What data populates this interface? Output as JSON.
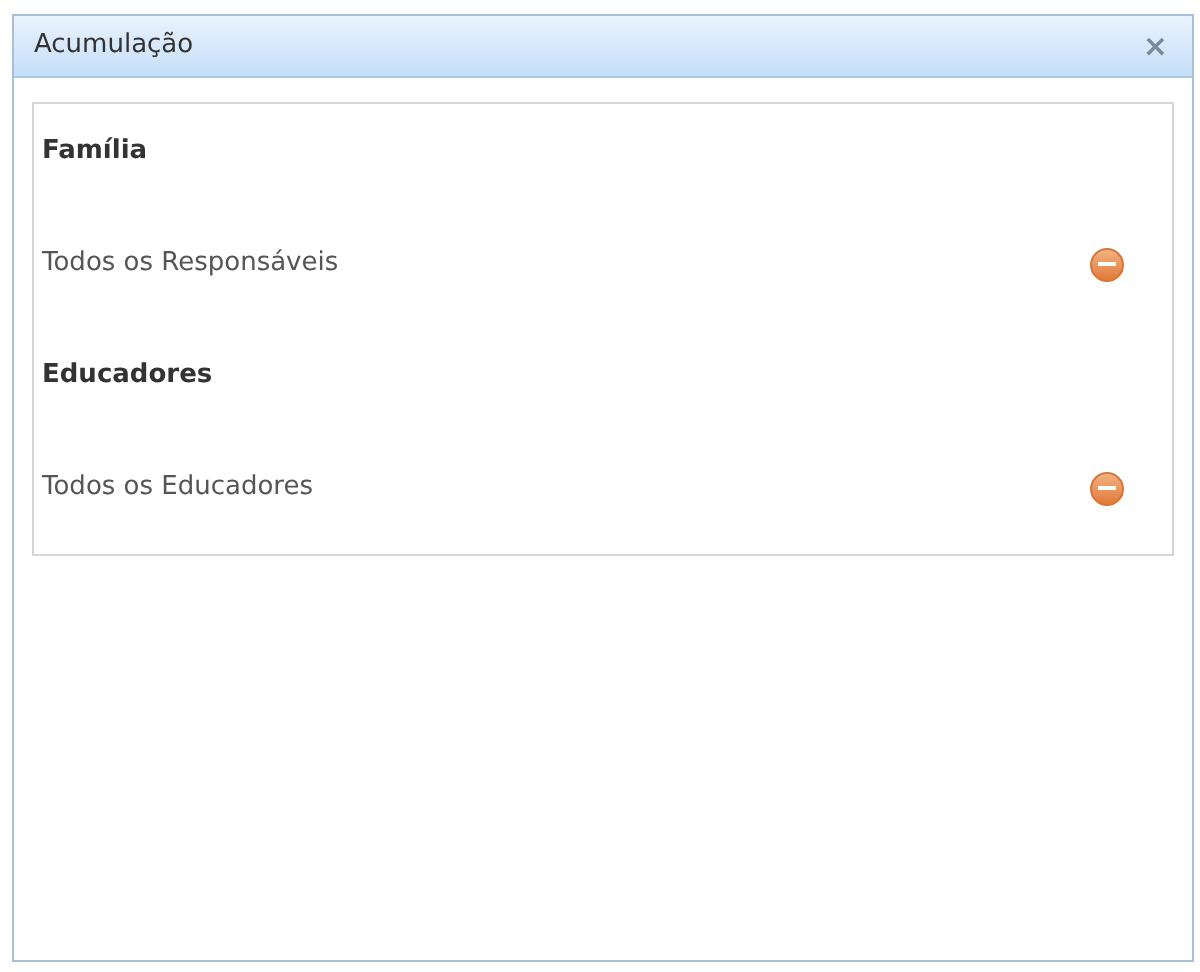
{
  "window": {
    "title": "Acumulação",
    "close": "×"
  },
  "sections": [
    {
      "heading": "Família",
      "items": [
        {
          "label": "Todos os Responsáveis"
        }
      ]
    },
    {
      "heading": "Educadores",
      "items": [
        {
          "label": "Todos os Educadores"
        }
      ]
    }
  ]
}
